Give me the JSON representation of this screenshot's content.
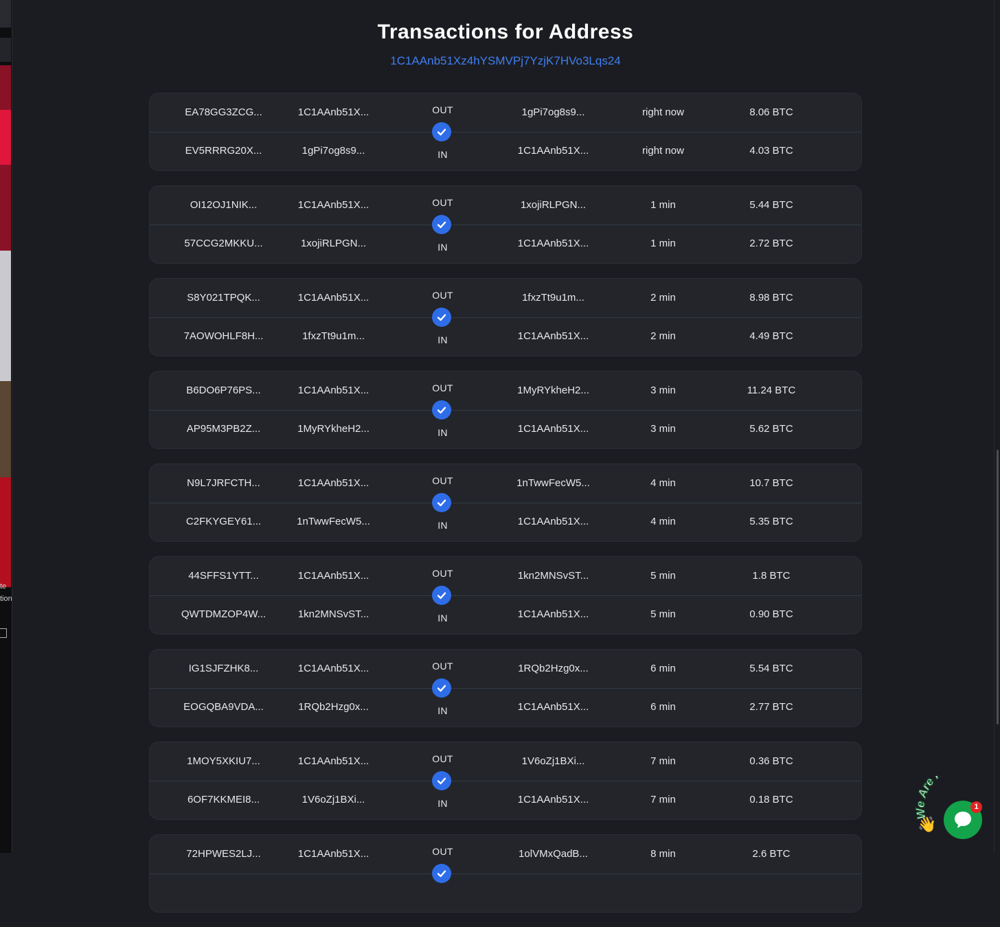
{
  "header": {
    "title": "Transactions for Address",
    "address": "1C1AAnb51Xz4hYSMVPj7YzjK7HVo3Lqs24"
  },
  "left_strip": {
    "texts": [
      "te",
      "tion"
    ]
  },
  "transactions": [
    {
      "out": {
        "hash": "EA78GG3ZCG...",
        "from": "1C1AAnb51X...",
        "direction": "OUT",
        "to": "1gPi7og8s9...",
        "time": "right now",
        "amount": "8.06 BTC"
      },
      "in": {
        "hash": "EV5RRRG20X...",
        "from": "1gPi7og8s9...",
        "direction": "IN",
        "to": "1C1AAnb51X...",
        "time": "right now",
        "amount": "4.03 BTC"
      }
    },
    {
      "out": {
        "hash": "OI12OJ1NIK...",
        "from": "1C1AAnb51X...",
        "direction": "OUT",
        "to": "1xojiRLPGN...",
        "time": "1 min",
        "amount": "5.44 BTC"
      },
      "in": {
        "hash": "57CCG2MKKU...",
        "from": "1xojiRLPGN...",
        "direction": "IN",
        "to": "1C1AAnb51X...",
        "time": "1 min",
        "amount": "2.72 BTC"
      }
    },
    {
      "out": {
        "hash": "S8Y021TPQK...",
        "from": "1C1AAnb51X...",
        "direction": "OUT",
        "to": "1fxzTt9u1m...",
        "time": "2 min",
        "amount": "8.98 BTC"
      },
      "in": {
        "hash": "7AOWOHLF8H...",
        "from": "1fxzTt9u1m...",
        "direction": "IN",
        "to": "1C1AAnb51X...",
        "time": "2 min",
        "amount": "4.49 BTC"
      }
    },
    {
      "out": {
        "hash": "B6DO6P76PS...",
        "from": "1C1AAnb51X...",
        "direction": "OUT",
        "to": "1MyRYkheH2...",
        "time": "3 min",
        "amount": "11.24 BTC"
      },
      "in": {
        "hash": "AP95M3PB2Z...",
        "from": "1MyRYkheH2...",
        "direction": "IN",
        "to": "1C1AAnb51X...",
        "time": "3 min",
        "amount": "5.62 BTC"
      }
    },
    {
      "out": {
        "hash": "N9L7JRFCTH...",
        "from": "1C1AAnb51X...",
        "direction": "OUT",
        "to": "1nTwwFecW5...",
        "time": "4 min",
        "amount": "10.7 BTC"
      },
      "in": {
        "hash": "C2FKYGEY61...",
        "from": "1nTwwFecW5...",
        "direction": "IN",
        "to": "1C1AAnb51X...",
        "time": "4 min",
        "amount": "5.35 BTC"
      }
    },
    {
      "out": {
        "hash": "44SFFS1YTT...",
        "from": "1C1AAnb51X...",
        "direction": "OUT",
        "to": "1kn2MNSvST...",
        "time": "5 min",
        "amount": "1.8 BTC"
      },
      "in": {
        "hash": "QWTDMZOP4W...",
        "from": "1kn2MNSvST...",
        "direction": "IN",
        "to": "1C1AAnb51X...",
        "time": "5 min",
        "amount": "0.90 BTC"
      }
    },
    {
      "out": {
        "hash": "IG1SJFZHK8...",
        "from": "1C1AAnb51X...",
        "direction": "OUT",
        "to": "1RQb2Hzg0x...",
        "time": "6 min",
        "amount": "5.54 BTC"
      },
      "in": {
        "hash": "EOGQBA9VDA...",
        "from": "1RQb2Hzg0x...",
        "direction": "IN",
        "to": "1C1AAnb51X...",
        "time": "6 min",
        "amount": "2.77 BTC"
      }
    },
    {
      "out": {
        "hash": "1MOY5XKIU7...",
        "from": "1C1AAnb51X...",
        "direction": "OUT",
        "to": "1V6oZj1BXi...",
        "time": "7 min",
        "amount": "0.36 BTC"
      },
      "in": {
        "hash": "6OF7KKMEI8...",
        "from": "1V6oZj1BXi...",
        "direction": "IN",
        "to": "1C1AAnb51X...",
        "time": "7 min",
        "amount": "0.18 BTC"
      }
    },
    {
      "out": {
        "hash": "72HPWES2LJ...",
        "from": "1C1AAnb51X...",
        "direction": "OUT",
        "to": "1olVMxQadB...",
        "time": "8 min",
        "amount": "2.6 BTC"
      },
      "in": {
        "hash": "",
        "from": "",
        "direction": "",
        "to": "",
        "time": "",
        "amount": ""
      }
    }
  ],
  "chat_widget": {
    "label": "We Are Here!",
    "badge_count": "1",
    "icon": "chat-bubble-icon"
  },
  "colors": {
    "background": "#1b1c21",
    "card": "#23252b",
    "accent": "#2f6de8",
    "address_link": "#3f7ff2",
    "chat": "#13a34b"
  }
}
